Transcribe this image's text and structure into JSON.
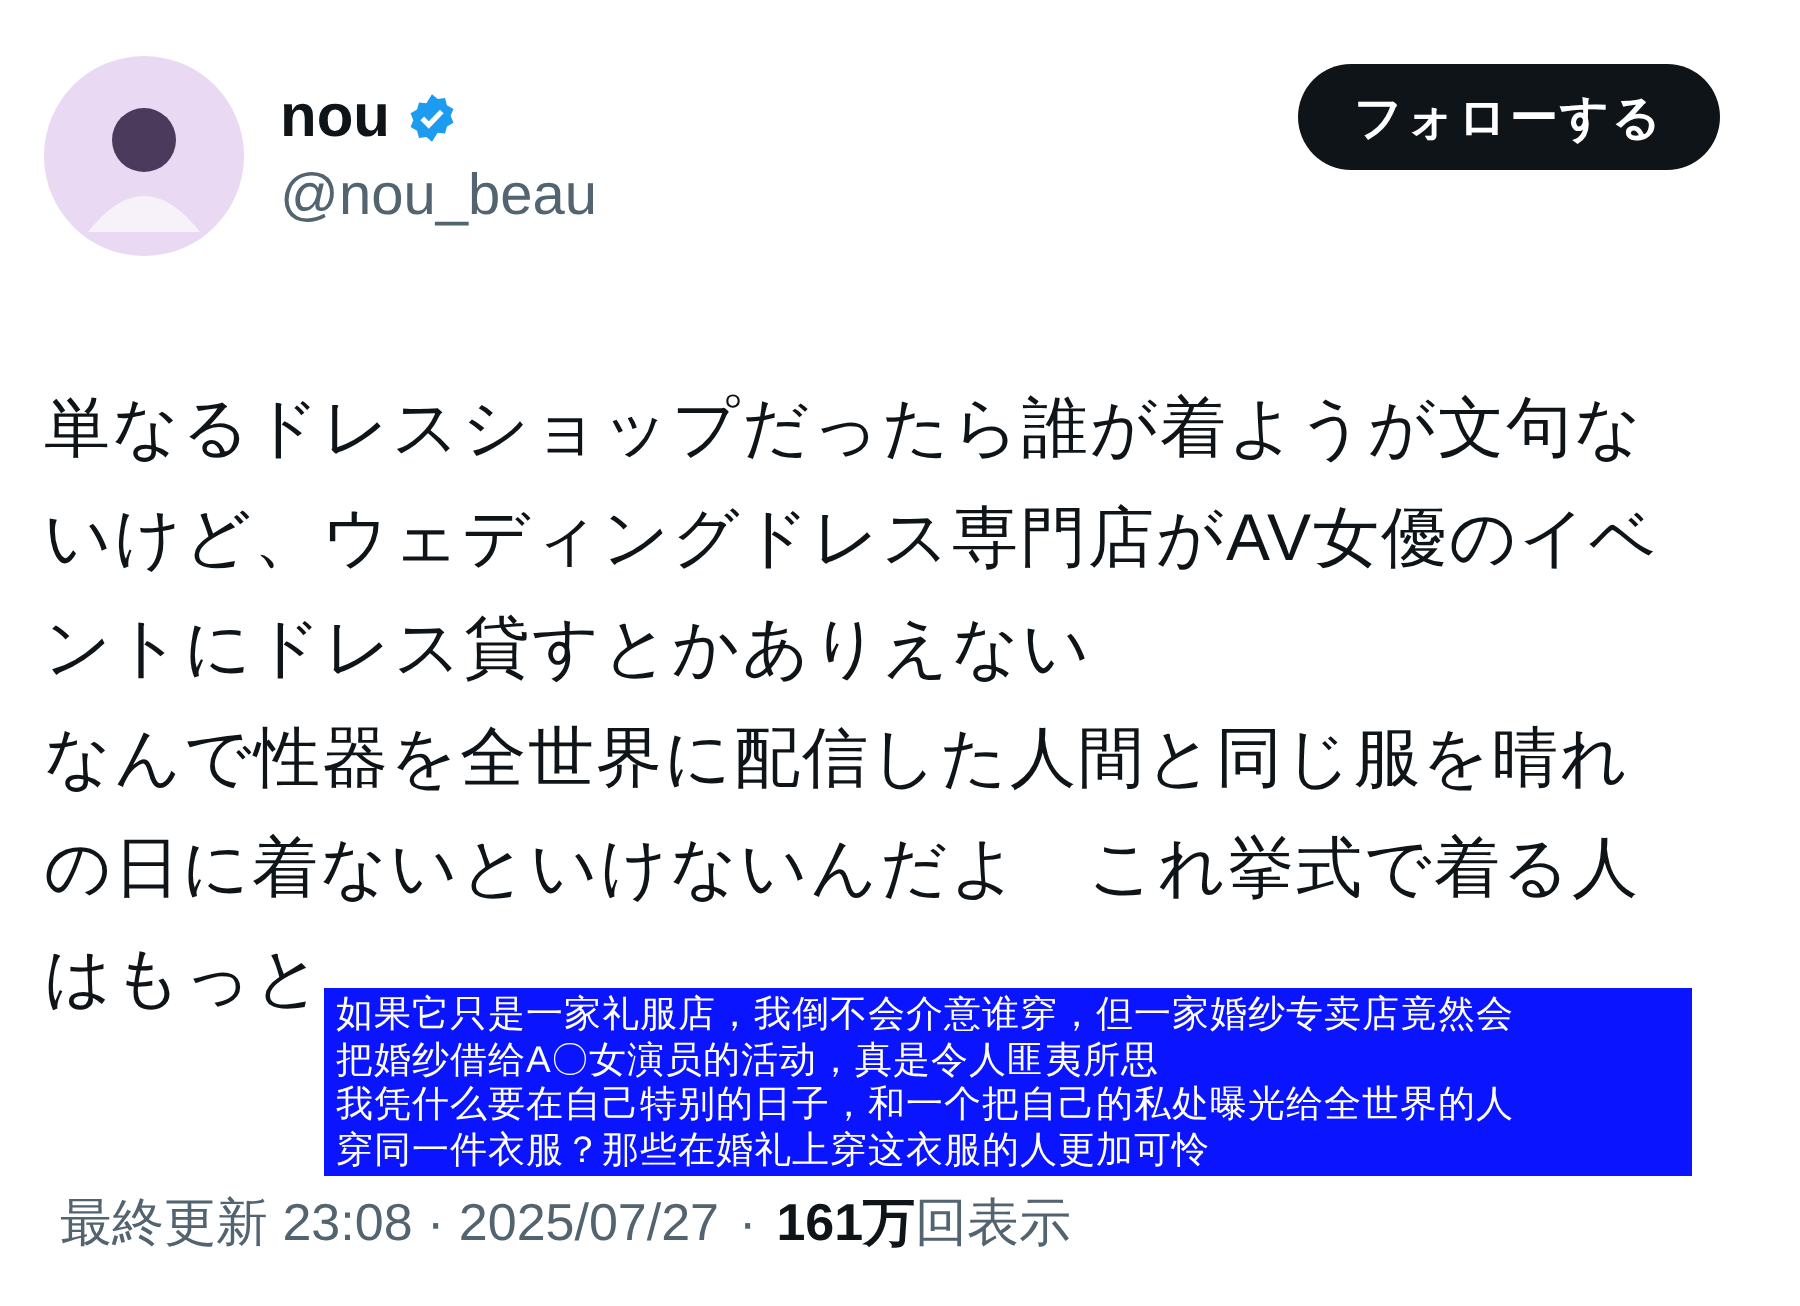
{
  "author": {
    "name": "nou",
    "verified": true,
    "handle": "@nou_beau"
  },
  "follow_button": {
    "label": "フォローする"
  },
  "body": {
    "lines": [
      "単なるドレスショップだったら誰が着ようが文句な",
      "いけど、ウェディングドレス専門店がAV女優のイベ",
      "ントにドレス貸すとかありえない",
      "なんで性器を全世界に配信した人間と同じ服を晴れ",
      "の日に着ないといけないんだよ　これ挙式で着る人",
      "はもっと"
    ]
  },
  "translation_overlay": {
    "lines": [
      "如果它只是一家礼服店，我倒不会介意谁穿，但一家婚纱专卖店竟然会",
      "把婚纱借给A〇女演员的活动，真是令人匪夷所思",
      "我凭什么要在自己特别的日子，和一个把自己的私处曝光给全世界的人",
      "穿同一件衣服？那些在婚礼上穿这衣服的人更加可怜"
    ]
  },
  "footer": {
    "timestamp": "最終更新 23:08 · 2025/07/27",
    "separator": "·",
    "views": "**161万**回表示"
  }
}
